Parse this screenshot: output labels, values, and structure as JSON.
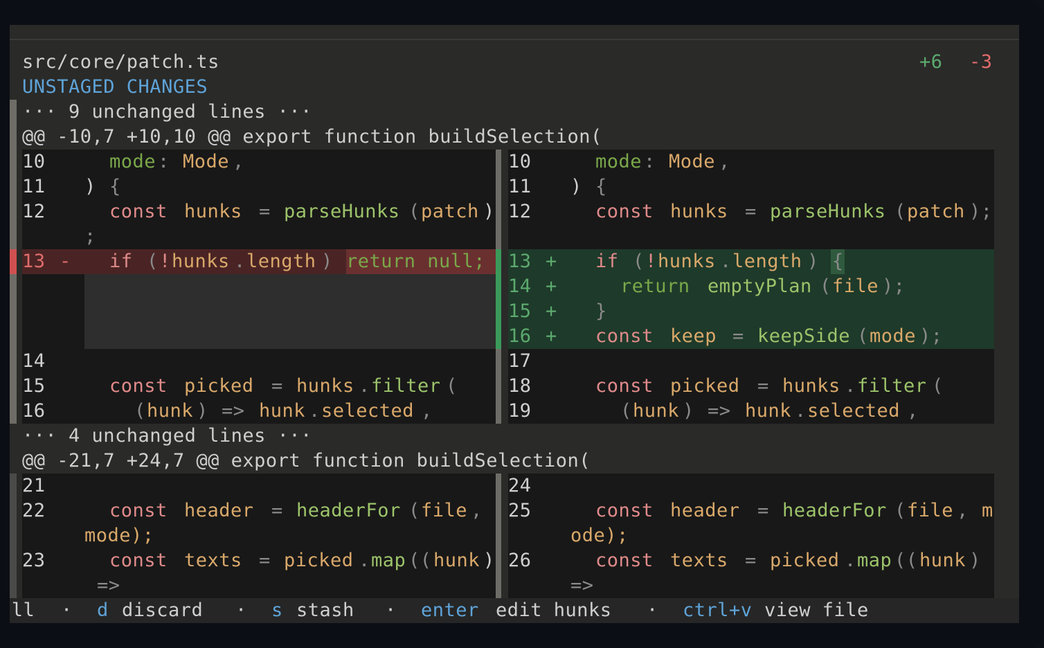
{
  "file": {
    "path": "src/core/patch.ts",
    "added": "+6",
    "removed": "-3"
  },
  "section_title": "UNSTAGED CHANGES",
  "fold1": "··· 9 unchanged lines ···",
  "hunk1": "@@ -10,7 +10,10 @@ export function buildSelection(",
  "fold2": "··· 4 unchanged lines ···",
  "hunk2": "@@ -21,7 +24,7 @@ export function buildSelection(",
  "left": {
    "l10": "10",
    "l11": "11",
    "l12": "12",
    "l13": "13",
    "l14": "14",
    "l15": "15",
    "l16": "16",
    "l21": "21",
    "l22": "22",
    "l23": "23",
    "minus": "-"
  },
  "right": {
    "l10": "10",
    "l11": "11",
    "l12": "12",
    "l13": "13",
    "l14": "14",
    "l15": "15",
    "l16": "16",
    "l17": "17",
    "l18": "18",
    "l19": "19",
    "l24": "24",
    "l25": "25",
    "l26": "26",
    "plus": "+"
  },
  "code": {
    "mode": "mode",
    "colon": ":",
    "Mode": "Mode",
    "comma": ",",
    "close_paren": ")",
    "open_brace": "{",
    "close_brace": "}",
    "const": "const",
    "hunks": "hunks",
    "eq": "=",
    "parseHunks": "parseHunks",
    "open_paren": "(",
    "patch": "patch",
    "semi": ";",
    "patch_close": "patch);",
    "if": "if",
    "bang": "!",
    "dot": ".",
    "length": "length",
    "return_null": "return null;",
    "return": "return",
    "emptyPlan": "emptyPlan",
    "file": "file",
    "close_semi": ");",
    "keep": "keep",
    "keepSide": "keepSide",
    "picked": "picked",
    "filter": "filter",
    "hunk": "hunk",
    "arrow": "=>",
    "selected": "selected",
    "header": "header",
    "headerFor": "headerFor",
    "mode_close": "mode);",
    "m": "m",
    "ode_close": "ode);",
    "texts": "texts",
    "map": "map",
    "open2": "(("
  },
  "footer": {
    "all": "all",
    "sep": "·",
    "key_d": "d",
    "label_d": "discard",
    "key_s": "s",
    "label_s": "stash",
    "key_enter": "enter",
    "label_enter": "edit hunks",
    "key_ctrlv": "ctrl+v",
    "label_ctrlv": "view file"
  },
  "colors": {
    "added": "#5caa6e",
    "removed": "#e06c6c",
    "accent": "#5ea3d8"
  }
}
